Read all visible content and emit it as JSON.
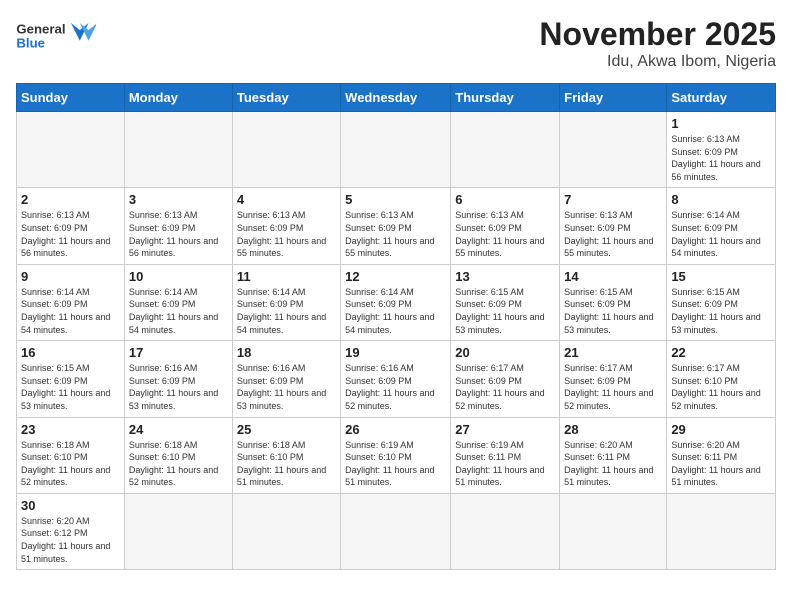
{
  "header": {
    "logo_general": "General",
    "logo_blue": "Blue",
    "title": "November 2025",
    "subtitle": "Idu, Akwa Ibom, Nigeria"
  },
  "calendar": {
    "days_of_week": [
      "Sunday",
      "Monday",
      "Tuesday",
      "Wednesday",
      "Thursday",
      "Friday",
      "Saturday"
    ],
    "weeks": [
      [
        {
          "day": "",
          "sunrise": "",
          "sunset": "",
          "daylight": "",
          "empty": true
        },
        {
          "day": "",
          "sunrise": "",
          "sunset": "",
          "daylight": "",
          "empty": true
        },
        {
          "day": "",
          "sunrise": "",
          "sunset": "",
          "daylight": "",
          "empty": true
        },
        {
          "day": "",
          "sunrise": "",
          "sunset": "",
          "daylight": "",
          "empty": true
        },
        {
          "day": "",
          "sunrise": "",
          "sunset": "",
          "daylight": "",
          "empty": true
        },
        {
          "day": "",
          "sunrise": "",
          "sunset": "",
          "daylight": "",
          "empty": true
        },
        {
          "day": "1",
          "sunrise": "Sunrise: 6:13 AM",
          "sunset": "Sunset: 6:09 PM",
          "daylight": "Daylight: 11 hours and 56 minutes.",
          "empty": false
        }
      ],
      [
        {
          "day": "2",
          "sunrise": "Sunrise: 6:13 AM",
          "sunset": "Sunset: 6:09 PM",
          "daylight": "Daylight: 11 hours and 56 minutes.",
          "empty": false
        },
        {
          "day": "3",
          "sunrise": "Sunrise: 6:13 AM",
          "sunset": "Sunset: 6:09 PM",
          "daylight": "Daylight: 11 hours and 56 minutes.",
          "empty": false
        },
        {
          "day": "4",
          "sunrise": "Sunrise: 6:13 AM",
          "sunset": "Sunset: 6:09 PM",
          "daylight": "Daylight: 11 hours and 55 minutes.",
          "empty": false
        },
        {
          "day": "5",
          "sunrise": "Sunrise: 6:13 AM",
          "sunset": "Sunset: 6:09 PM",
          "daylight": "Daylight: 11 hours and 55 minutes.",
          "empty": false
        },
        {
          "day": "6",
          "sunrise": "Sunrise: 6:13 AM",
          "sunset": "Sunset: 6:09 PM",
          "daylight": "Daylight: 11 hours and 55 minutes.",
          "empty": false
        },
        {
          "day": "7",
          "sunrise": "Sunrise: 6:13 AM",
          "sunset": "Sunset: 6:09 PM",
          "daylight": "Daylight: 11 hours and 55 minutes.",
          "empty": false
        },
        {
          "day": "8",
          "sunrise": "Sunrise: 6:14 AM",
          "sunset": "Sunset: 6:09 PM",
          "daylight": "Daylight: 11 hours and 54 minutes.",
          "empty": false
        }
      ],
      [
        {
          "day": "9",
          "sunrise": "Sunrise: 6:14 AM",
          "sunset": "Sunset: 6:09 PM",
          "daylight": "Daylight: 11 hours and 54 minutes.",
          "empty": false
        },
        {
          "day": "10",
          "sunrise": "Sunrise: 6:14 AM",
          "sunset": "Sunset: 6:09 PM",
          "daylight": "Daylight: 11 hours and 54 minutes.",
          "empty": false
        },
        {
          "day": "11",
          "sunrise": "Sunrise: 6:14 AM",
          "sunset": "Sunset: 6:09 PM",
          "daylight": "Daylight: 11 hours and 54 minutes.",
          "empty": false
        },
        {
          "day": "12",
          "sunrise": "Sunrise: 6:14 AM",
          "sunset": "Sunset: 6:09 PM",
          "daylight": "Daylight: 11 hours and 54 minutes.",
          "empty": false
        },
        {
          "day": "13",
          "sunrise": "Sunrise: 6:15 AM",
          "sunset": "Sunset: 6:09 PM",
          "daylight": "Daylight: 11 hours and 53 minutes.",
          "empty": false
        },
        {
          "day": "14",
          "sunrise": "Sunrise: 6:15 AM",
          "sunset": "Sunset: 6:09 PM",
          "daylight": "Daylight: 11 hours and 53 minutes.",
          "empty": false
        },
        {
          "day": "15",
          "sunrise": "Sunrise: 6:15 AM",
          "sunset": "Sunset: 6:09 PM",
          "daylight": "Daylight: 11 hours and 53 minutes.",
          "empty": false
        }
      ],
      [
        {
          "day": "16",
          "sunrise": "Sunrise: 6:15 AM",
          "sunset": "Sunset: 6:09 PM",
          "daylight": "Daylight: 11 hours and 53 minutes.",
          "empty": false
        },
        {
          "day": "17",
          "sunrise": "Sunrise: 6:16 AM",
          "sunset": "Sunset: 6:09 PM",
          "daylight": "Daylight: 11 hours and 53 minutes.",
          "empty": false
        },
        {
          "day": "18",
          "sunrise": "Sunrise: 6:16 AM",
          "sunset": "Sunset: 6:09 PM",
          "daylight": "Daylight: 11 hours and 53 minutes.",
          "empty": false
        },
        {
          "day": "19",
          "sunrise": "Sunrise: 6:16 AM",
          "sunset": "Sunset: 6:09 PM",
          "daylight": "Daylight: 11 hours and 52 minutes.",
          "empty": false
        },
        {
          "day": "20",
          "sunrise": "Sunrise: 6:17 AM",
          "sunset": "Sunset: 6:09 PM",
          "daylight": "Daylight: 11 hours and 52 minutes.",
          "empty": false
        },
        {
          "day": "21",
          "sunrise": "Sunrise: 6:17 AM",
          "sunset": "Sunset: 6:09 PM",
          "daylight": "Daylight: 11 hours and 52 minutes.",
          "empty": false
        },
        {
          "day": "22",
          "sunrise": "Sunrise: 6:17 AM",
          "sunset": "Sunset: 6:10 PM",
          "daylight": "Daylight: 11 hours and 52 minutes.",
          "empty": false
        }
      ],
      [
        {
          "day": "23",
          "sunrise": "Sunrise: 6:18 AM",
          "sunset": "Sunset: 6:10 PM",
          "daylight": "Daylight: 11 hours and 52 minutes.",
          "empty": false
        },
        {
          "day": "24",
          "sunrise": "Sunrise: 6:18 AM",
          "sunset": "Sunset: 6:10 PM",
          "daylight": "Daylight: 11 hours and 52 minutes.",
          "empty": false
        },
        {
          "day": "25",
          "sunrise": "Sunrise: 6:18 AM",
          "sunset": "Sunset: 6:10 PM",
          "daylight": "Daylight: 11 hours and 51 minutes.",
          "empty": false
        },
        {
          "day": "26",
          "sunrise": "Sunrise: 6:19 AM",
          "sunset": "Sunset: 6:10 PM",
          "daylight": "Daylight: 11 hours and 51 minutes.",
          "empty": false
        },
        {
          "day": "27",
          "sunrise": "Sunrise: 6:19 AM",
          "sunset": "Sunset: 6:11 PM",
          "daylight": "Daylight: 11 hours and 51 minutes.",
          "empty": false
        },
        {
          "day": "28",
          "sunrise": "Sunrise: 6:20 AM",
          "sunset": "Sunset: 6:11 PM",
          "daylight": "Daylight: 11 hours and 51 minutes.",
          "empty": false
        },
        {
          "day": "29",
          "sunrise": "Sunrise: 6:20 AM",
          "sunset": "Sunset: 6:11 PM",
          "daylight": "Daylight: 11 hours and 51 minutes.",
          "empty": false
        }
      ],
      [
        {
          "day": "30",
          "sunrise": "Sunrise: 6:20 AM",
          "sunset": "Sunset: 6:12 PM",
          "daylight": "Daylight: 11 hours and 51 minutes.",
          "empty": false
        },
        {
          "day": "",
          "sunrise": "",
          "sunset": "",
          "daylight": "",
          "empty": true
        },
        {
          "day": "",
          "sunrise": "",
          "sunset": "",
          "daylight": "",
          "empty": true
        },
        {
          "day": "",
          "sunrise": "",
          "sunset": "",
          "daylight": "",
          "empty": true
        },
        {
          "day": "",
          "sunrise": "",
          "sunset": "",
          "daylight": "",
          "empty": true
        },
        {
          "day": "",
          "sunrise": "",
          "sunset": "",
          "daylight": "",
          "empty": true
        },
        {
          "day": "",
          "sunrise": "",
          "sunset": "",
          "daylight": "",
          "empty": true
        }
      ]
    ]
  }
}
